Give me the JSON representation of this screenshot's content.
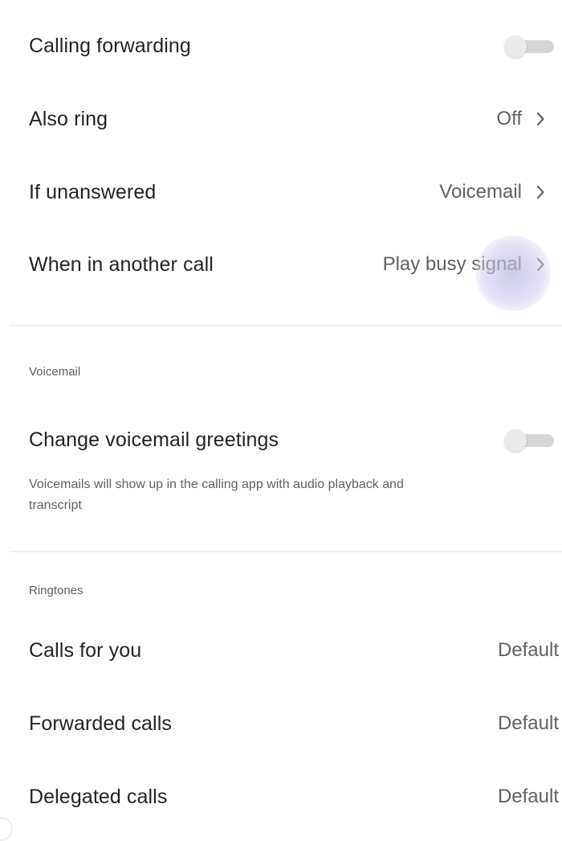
{
  "call_handling": {
    "rows": [
      {
        "label": "Calling forwarding",
        "control": "toggle",
        "toggle_state": "off"
      },
      {
        "label": "Also ring",
        "value": "Off",
        "control": "chevron"
      },
      {
        "label": "If unanswered",
        "value": "Voicemail",
        "control": "chevron"
      },
      {
        "label": "When in another call",
        "value": "Play busy signal",
        "control": "chevron"
      }
    ]
  },
  "voicemail": {
    "header": "Voicemail",
    "greeting_label": "Change voicemail greetings",
    "greeting_toggle_state": "off",
    "description": "Voicemails will show up in the calling app with audio playback and transcript"
  },
  "ringtones": {
    "header": "Ringtones",
    "rows": [
      {
        "label": "Calls for you",
        "value": "Default"
      },
      {
        "label": "Forwarded calls",
        "value": "Default"
      },
      {
        "label": "Delegated calls",
        "value": "Default"
      }
    ]
  },
  "icons": {
    "chevron": "chevron-right-icon",
    "toggle": "toggle-switch"
  },
  "colors": {
    "touch_ripple": "#bbb8e2",
    "toggle_track_off": "#d6d6d6",
    "secondary_text": "#616161"
  }
}
